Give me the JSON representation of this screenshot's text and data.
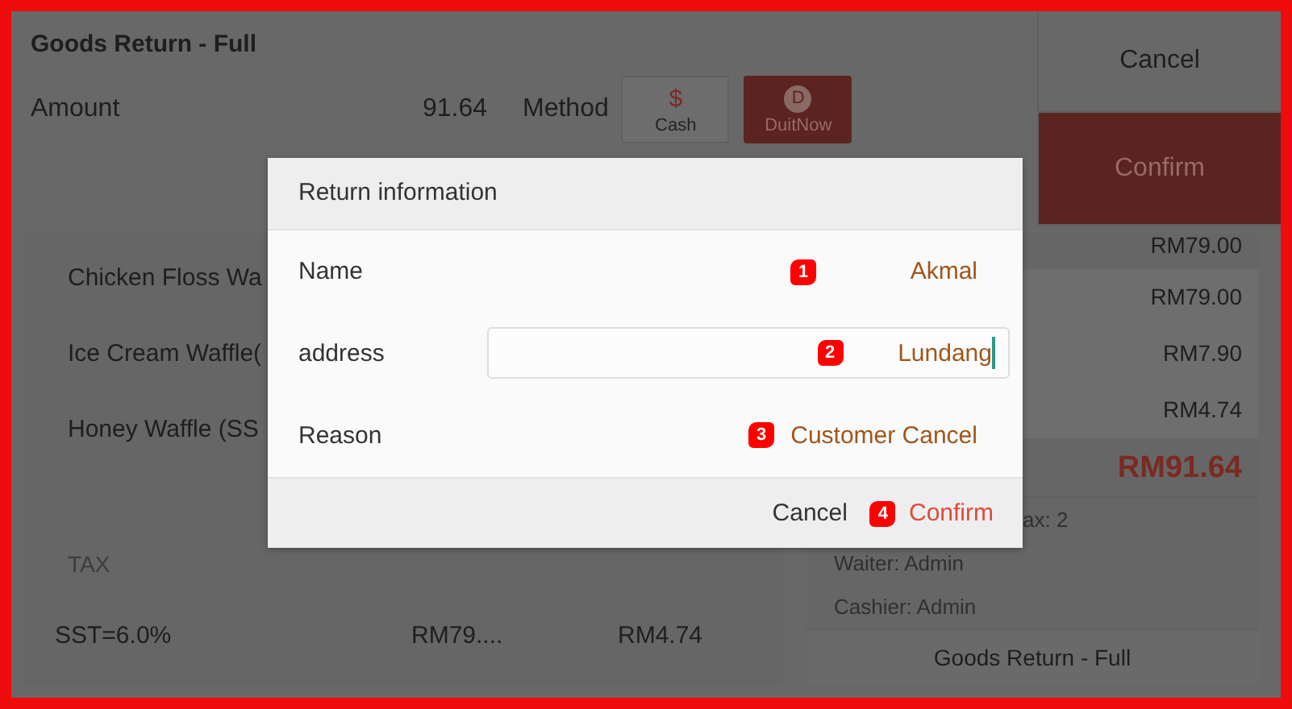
{
  "header": {
    "title": "Goods Return - Full",
    "amount_label": "Amount",
    "amount": "91.64",
    "method_label": "Method",
    "methods": [
      {
        "label": "Cash",
        "icon": "$",
        "selected": false
      },
      {
        "label": "DuitNow",
        "icon": "D",
        "selected": true
      }
    ]
  },
  "actions": [
    {
      "label": "Cancel",
      "kind": "plain"
    },
    {
      "label": "Confirm",
      "kind": "primary"
    }
  ],
  "items": [
    {
      "name": "Chicken Floss Wa"
    },
    {
      "name": "Ice Cream Waffle("
    },
    {
      "name": "Honey Waffle (SS"
    }
  ],
  "tax_table": {
    "columns": [
      "TAX"
    ],
    "rows": [
      [
        "SST=6.0%",
        "RM79....",
        "RM4.74"
      ]
    ]
  },
  "summary": {
    "prices": [
      {
        "value": "RM79.00",
        "boxed": false
      },
      {
        "value": "RM79.00",
        "boxed": true
      },
      {
        "value": "RM7.90",
        "boxed": true
      },
      {
        "value": "RM4.74",
        "boxed": true
      }
    ],
    "total": "RM91.64",
    "info": [
      "ax: 2",
      "Waiter: Admin",
      "Cashier: Admin"
    ],
    "button": "Goods Return - Full"
  },
  "dialog": {
    "title": "Return information",
    "fields": [
      {
        "label": "Name",
        "kind": "text",
        "value": "Akmal",
        "marker": "1"
      },
      {
        "label": "address",
        "kind": "input",
        "value": "Lundang",
        "marker": "2"
      },
      {
        "label": "Reason",
        "kind": "text",
        "value": "Customer Cancel",
        "marker": "3"
      }
    ],
    "buttons": [
      {
        "label": "Cancel",
        "kind": "plain"
      },
      {
        "label": "Confirm",
        "kind": "primary",
        "marker": "4"
      }
    ]
  }
}
